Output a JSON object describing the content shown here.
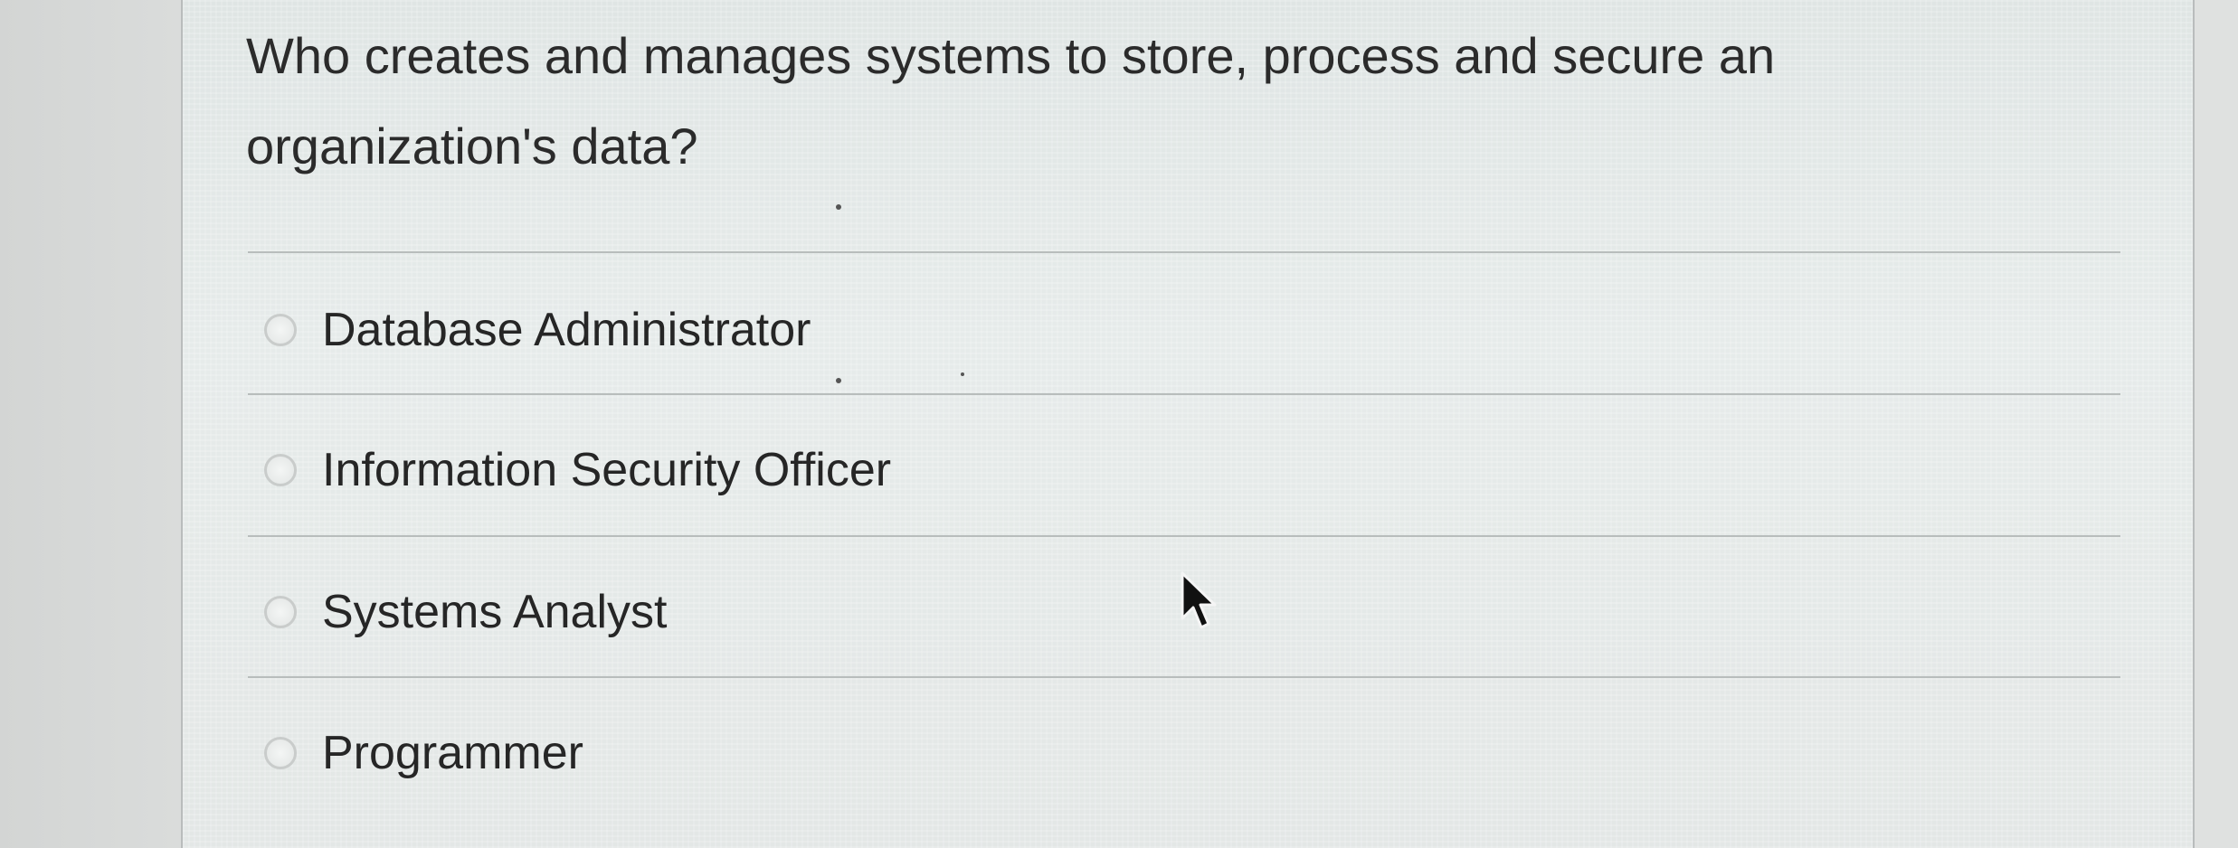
{
  "question": {
    "text": "Who creates and manages systems to store, process and secure an organization's data?"
  },
  "options": [
    {
      "label": "Database Administrator",
      "selected": false
    },
    {
      "label": "Information Security Officer",
      "selected": false
    },
    {
      "label": "Systems Analyst",
      "selected": false
    },
    {
      "label": "Programmer",
      "selected": false
    }
  ],
  "icons": {
    "radio": "radio-button-unchecked",
    "cursor": "mouse-pointer-arrow"
  },
  "colors": {
    "text": "#262626",
    "divider": "#b8bdbc",
    "panel": "#e3e8e7"
  }
}
